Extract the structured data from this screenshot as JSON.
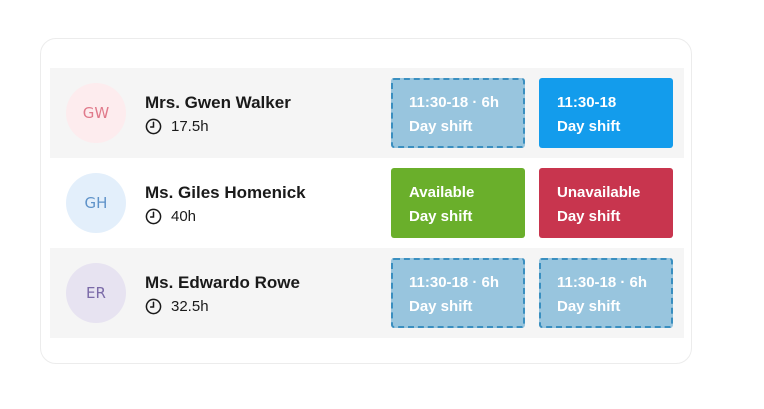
{
  "employees": [
    {
      "initials": "GW",
      "name": "Mrs. Gwen Walker",
      "hours": "17.5h",
      "avatar_bg": "#fdecee",
      "avatar_color": "#e07a8b",
      "shifts": [
        {
          "line1": "11:30-18 · 6h",
          "line2": "Day shift",
          "status": "pending"
        },
        {
          "line1": "11:30-18",
          "line2": "Day shift",
          "status": "assigned"
        }
      ]
    },
    {
      "initials": "GH",
      "name": "Ms. Giles Homenick",
      "hours": "40h",
      "avatar_bg": "#e3effb",
      "avatar_color": "#5f93c9",
      "shifts": [
        {
          "line1": "Available",
          "line2": "Day shift",
          "status": "available"
        },
        {
          "line1": "Unavailable",
          "line2": "Day shift",
          "status": "unavailable"
        }
      ]
    },
    {
      "initials": "ER",
      "name": "Ms. Edwardo Rowe",
      "hours": "32.5h",
      "avatar_bg": "#e7e3f1",
      "avatar_color": "#7b6aa8",
      "shifts": [
        {
          "line1": "11:30-18 · 6h",
          "line2": "Day shift",
          "status": "pending"
        },
        {
          "line1": "11:30-18 · 6h",
          "line2": "Day shift",
          "status": "pending"
        }
      ]
    }
  ],
  "colors": {
    "pending": "#98c5de",
    "pending_border": "#3a8fc0",
    "assigned": "#139cec",
    "available": "#6aaf2b",
    "unavailable": "#c8354e",
    "row_shade": "#f5f5f5"
  },
  "icons": {
    "hours": "clock-icon"
  }
}
